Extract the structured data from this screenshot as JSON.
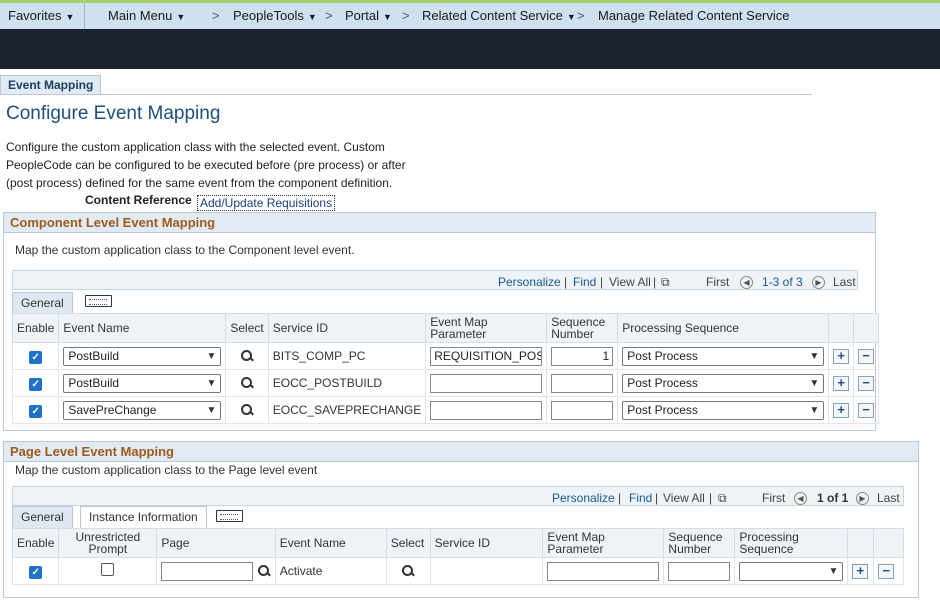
{
  "nav": {
    "favorites": "Favorites",
    "main_menu": "Main Menu",
    "peopletools": "PeopleTools",
    "portal": "Portal",
    "related_content_service": "Related Content Service",
    "manage": "Manage Related Content Service",
    "sep": ">"
  },
  "page": {
    "tab": "Event Mapping",
    "title": "Configure Event Mapping",
    "description": "Configure the custom application class with the selected event. Custom PeopleCode can be configured to be executed before (pre process) or after (post process) defined for the same event from the component definition.",
    "content_ref_label": "Content Reference",
    "content_ref_value": "Add/Update Requisitions"
  },
  "component": {
    "header": "Component Level Event Mapping",
    "instruction": "Map the custom application class to the Component level event.",
    "nav": {
      "personalize": "Personalize",
      "find": "Find",
      "view_all": "View All",
      "first": "First",
      "count": "1-3 of 3",
      "last": "Last"
    },
    "tab_general": "General",
    "columns": {
      "enable": "Enable",
      "event_name": "Event Name",
      "select": "Select",
      "service_id": "Service ID",
      "event_map_param": "Event Map Parameter",
      "seq_num": "Sequence Number",
      "proc_seq": "Processing Sequence"
    },
    "rows": [
      {
        "event": "PostBuild",
        "service": "BITS_COMP_PC",
        "param": "REQUISITION_POS",
        "seq": "1",
        "proc": "Post Process"
      },
      {
        "event": "PostBuild",
        "service": "EOCC_POSTBUILD",
        "param": "",
        "seq": "",
        "proc": "Post Process"
      },
      {
        "event": "SavePreChange",
        "service": "EOCC_SAVEPRECHANGE",
        "param": "",
        "seq": "",
        "proc": "Post Process"
      }
    ]
  },
  "pagelevel": {
    "header": "Page Level Event Mapping",
    "instruction": "Map the custom application class to the Page level event",
    "nav": {
      "personalize": "Personalize",
      "find": "Find",
      "view_all": "View All",
      "first": "First",
      "count": "1 of 1",
      "last": "Last"
    },
    "tab_general": "General",
    "tab_instance": "Instance Information",
    "columns": {
      "enable": "Enable",
      "unrestricted": "Unrestricted Prompt",
      "page": "Page",
      "event_name": "Event Name",
      "select": "Select",
      "service_id": "Service ID",
      "event_map_param": "Event Map Parameter",
      "seq_num": "Sequence Number",
      "proc_seq": "Processing Sequence"
    },
    "row": {
      "event": "Activate"
    }
  },
  "colors": {
    "accent": "#1e72c8",
    "header_brown": "#9c5b1d",
    "title_blue": "#1d4f7c",
    "nav_bg": "#cfe0ee",
    "dark_band": "#1b2230"
  }
}
